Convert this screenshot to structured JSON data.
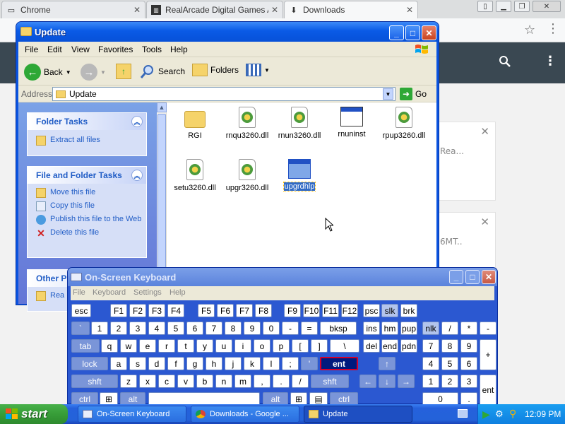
{
  "chrome": {
    "tabs": [
      {
        "label": "Chrome",
        "icon": "doc-icon"
      },
      {
        "label": "RealArcade Digital Games Ar",
        "icon": "realarcade-icon"
      },
      {
        "label": "Downloads",
        "icon": "download-icon"
      }
    ],
    "cards": [
      {
        "text": "Rea..."
      },
      {
        "text": "6MT.."
      }
    ]
  },
  "explorer": {
    "title": "Update",
    "menu": [
      "File",
      "Edit",
      "View",
      "Favorites",
      "Tools",
      "Help"
    ],
    "toolbar": {
      "back": "Back",
      "search": "Search",
      "folders": "Folders"
    },
    "address": {
      "label": "Address",
      "value": "Update",
      "go": "Go"
    },
    "folder_tasks": {
      "title": "Folder Tasks",
      "items": [
        "Extract all files"
      ]
    },
    "file_tasks": {
      "title": "File and Folder Tasks",
      "items": [
        "Move this file",
        "Copy this file",
        "Publish this file to the Web",
        "Delete this file"
      ]
    },
    "other_places": {
      "title": "Other P",
      "items": [
        "Rea"
      ]
    },
    "files": [
      "RGI",
      "rnqu3260.dll",
      "rnun3260.dll",
      "rnuninst",
      "rpup3260.dll",
      "setu3260.dll",
      "upgr3260.dll",
      "upgrdhlp"
    ]
  },
  "osk": {
    "title": "On-Screen Keyboard",
    "menu": [
      "File",
      "Keyboard",
      "Settings",
      "Help"
    ],
    "row1": [
      "esc",
      "F1",
      "F2",
      "F3",
      "F4",
      "F5",
      "F6",
      "F7",
      "F8",
      "F9",
      "F10",
      "F11",
      "F12",
      "psc",
      "slk",
      "brk"
    ],
    "row2": [
      "`",
      "1",
      "2",
      "3",
      "4",
      "5",
      "6",
      "7",
      "8",
      "9",
      "0",
      "-",
      "=",
      "bksp",
      "ins",
      "hm",
      "pup",
      "nlk",
      "/",
      "*",
      "-"
    ],
    "row3": [
      "tab",
      "q",
      "w",
      "e",
      "r",
      "t",
      "y",
      "u",
      "i",
      "o",
      "p",
      "[",
      "]",
      "\\",
      "del",
      "end",
      "pdn",
      "7",
      "8",
      "9",
      "+"
    ],
    "row4": [
      "lock",
      "a",
      "s",
      "d",
      "f",
      "g",
      "h",
      "j",
      "k",
      "l",
      ";",
      "'",
      "ent",
      "4",
      "5",
      "6"
    ],
    "row5": [
      "shft",
      "z",
      "x",
      "c",
      "v",
      "b",
      "n",
      "m",
      ",",
      ".",
      "/",
      "shft",
      "1",
      "2",
      "3",
      "ent"
    ],
    "row6": [
      "ctrl",
      "alt",
      "alt",
      "ctrl",
      "0",
      "."
    ]
  },
  "taskbar": {
    "start": "start",
    "buttons": [
      "On-Screen Keyboard",
      "Downloads - Google ...",
      "Update"
    ],
    "clock": "12:09 PM"
  },
  "colors": {
    "xp_blue": "#0a54e0",
    "osk_blue": "#2b58d1",
    "start_green": "#379d38",
    "chrome_header": "#3a4852"
  }
}
